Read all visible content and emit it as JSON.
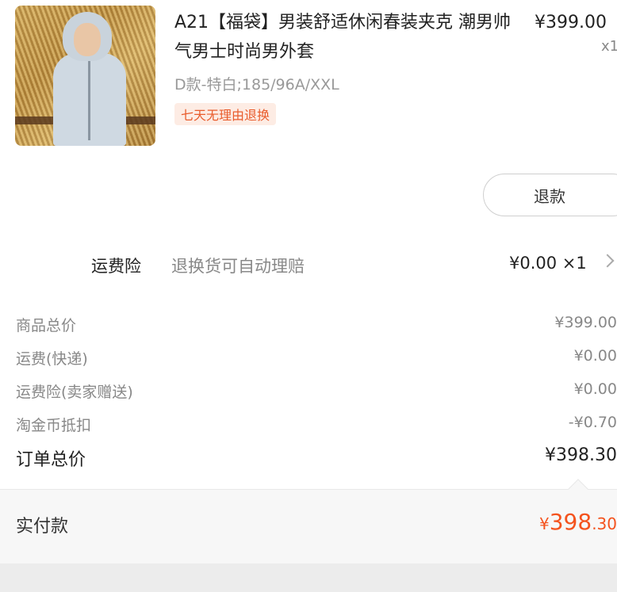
{
  "product": {
    "title": "A21【福袋】男装舒适休闲春装夹克 潮男帅气男士时尚男外套",
    "price": "¥399.00",
    "quantity": "x1",
    "sku": "D款-特白;185/96A/XXL",
    "tag": "七天无理由退换",
    "refund_button": "退款",
    "image_icon": "product-photo"
  },
  "insurance": {
    "label": "运费险",
    "description": "退换货可自动理赔",
    "price": "¥0.00 ×1",
    "icon": "chevron-right-icon"
  },
  "fees": [
    {
      "label": "商品总价",
      "value": "¥399.00"
    },
    {
      "label": "运费(快递)",
      "value": "¥0.00"
    },
    {
      "label": "运费险(卖家赠送)",
      "value": "¥0.00"
    },
    {
      "label": "淘金币抵扣",
      "value": "-¥0.70"
    }
  ],
  "total": {
    "label": "订单总价",
    "value": "¥398.30"
  },
  "paid": {
    "label": "实付款",
    "symbol": "¥",
    "integer": "398",
    "decimal": ".30"
  },
  "colors": {
    "accent": "#f4531e",
    "tag_text": "#e95c2c",
    "tag_bg": "#fdece4"
  }
}
